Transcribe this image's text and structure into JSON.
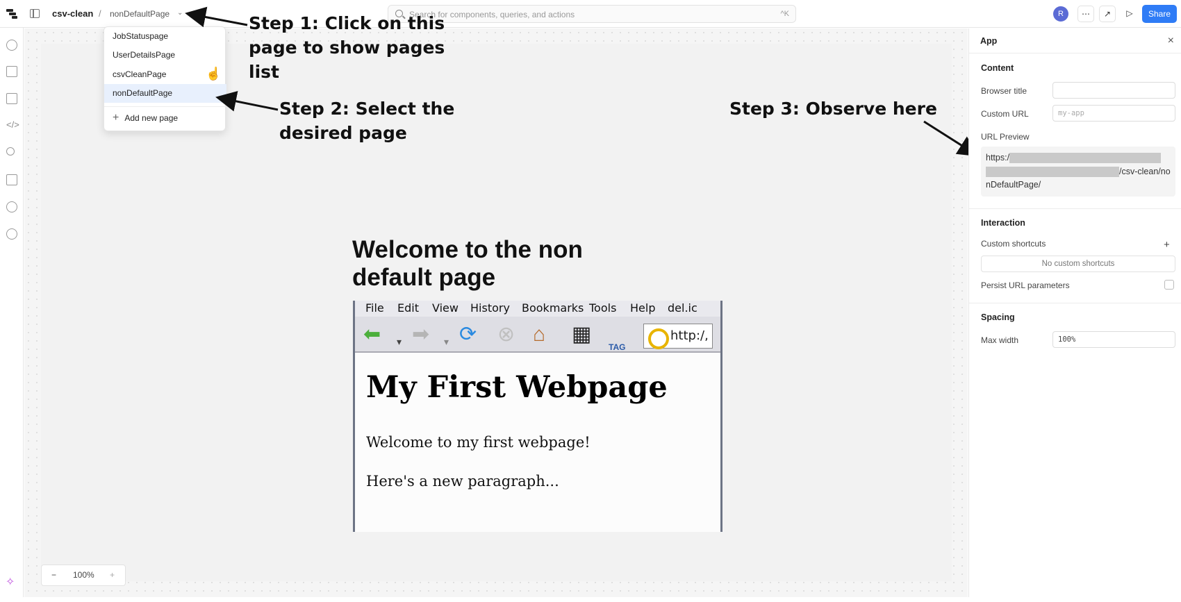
{
  "topbar": {
    "app_name": "csv-clean",
    "separator": "/",
    "current_page": "nonDefaultPage",
    "search_placeholder": "Search for components, queries, and actions",
    "search_shortcut": "^K",
    "avatar_initial": "R",
    "share_label": "Share"
  },
  "pages_dropdown": {
    "items": [
      {
        "label": "JobStatuspage",
        "selected": false
      },
      {
        "label": "UserDetailsPage",
        "selected": false
      },
      {
        "label": "csvCleanPage",
        "selected": false
      },
      {
        "label": "nonDefaultPage",
        "selected": true
      }
    ],
    "add_label": "Add new page"
  },
  "canvas": {
    "heading": "Welcome to the non default page",
    "embedded_image": {
      "menu": [
        "File",
        "Edit",
        "View",
        "History",
        "Bookmarks",
        "Tools",
        "Help",
        "del.ic"
      ],
      "url_text": "http:/,",
      "tag_text": "TAG",
      "title": "My First Webpage",
      "paragraph1": "Welcome to my first webpage!",
      "paragraph2": "Here's a new paragraph..."
    }
  },
  "annotations": {
    "step1": "Step 1: Click on this page to show pages list",
    "step2": "Step 2: Select the desired page",
    "step3": "Step 3: Observe here"
  },
  "inspector": {
    "title": "App",
    "content_section": "Content",
    "browser_title_label": "Browser title",
    "browser_title_value": "",
    "custom_url_label": "Custom URL",
    "custom_url_placeholder": "my-app",
    "url_preview_label": "URL Preview",
    "url_preview_start": "https:/",
    "url_preview_end": "/csv-clean/nonDefaultPage/",
    "interaction_section": "Interaction",
    "custom_shortcuts_label": "Custom shortcuts",
    "no_shortcuts": "No custom shortcuts",
    "persist_url_label": "Persist URL parameters",
    "spacing_section": "Spacing",
    "max_width_label": "Max width",
    "max_width_value": "100%"
  },
  "zoom": {
    "minus": "−",
    "value": "100%",
    "plus": "+"
  },
  "icons": [
    "logo-icon",
    "layout-icon",
    "search-icon",
    "more-icon",
    "expand-icon",
    "play-icon",
    "add-component-icon",
    "pages-icon",
    "tree-icon",
    "code-icon",
    "search-sidebar-icon",
    "state-icon",
    "history-icon",
    "settings-icon",
    "ai-assist-icon",
    "close-icon"
  ]
}
